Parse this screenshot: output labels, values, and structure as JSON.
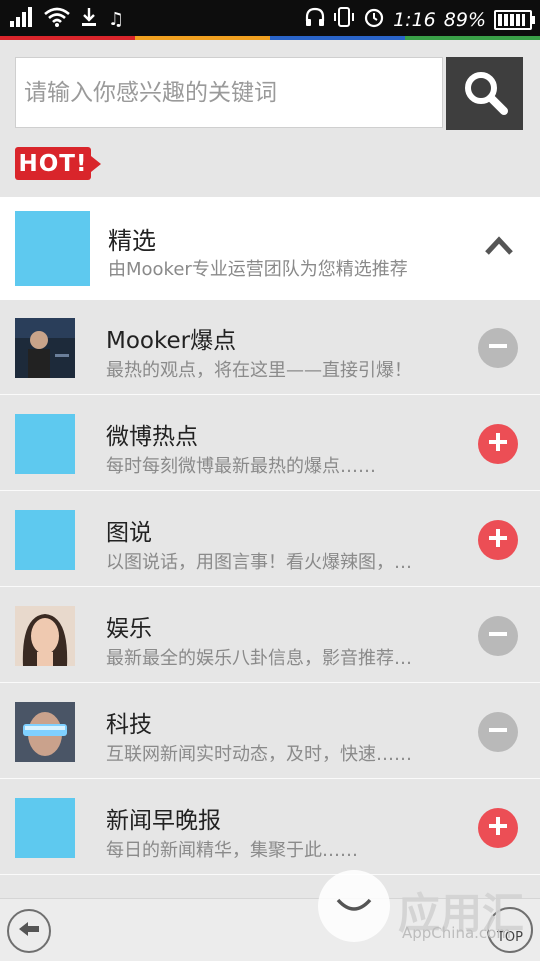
{
  "status_bar": {
    "time": "1:16",
    "battery_percent": "89%",
    "battery_level": 0.89
  },
  "search": {
    "placeholder": "请输入你感兴趣的关键词"
  },
  "hot_badge": "HOT!",
  "featured": {
    "title": "精选",
    "description": "由Mooker专业运营团队为您精选推荐"
  },
  "items": [
    {
      "title": "Mooker爆点",
      "description": "最热的观点，将在这里——直接引爆！",
      "subscribed": true,
      "thumb": "photo-person-stage"
    },
    {
      "title": "微博热点",
      "description": "每时每刻微博最新最热的爆点……",
      "subscribed": false,
      "thumb": "blue-placeholder"
    },
    {
      "title": "图说",
      "description": "以图说话，用图言事！看火爆辣图，…",
      "subscribed": false,
      "thumb": "blue-placeholder"
    },
    {
      "title": "娱乐",
      "description": "最新最全的娱乐八卦信息，影音推荐…",
      "subscribed": true,
      "thumb": "photo-woman-portrait"
    },
    {
      "title": "科技",
      "description": "互联网新闻实时动态，及时，快速……",
      "subscribed": true,
      "thumb": "photo-vr-glasses"
    },
    {
      "title": "新闻早晚报",
      "description": "每日的新闻精华，集聚于此……",
      "subscribed": false,
      "thumb": "blue-placeholder"
    }
  ],
  "bottom": {
    "top_label": "TOP"
  },
  "watermark": {
    "name": "应用汇",
    "sub": "AppChina.com"
  },
  "colors": {
    "accent_blue": "#5ec9ef",
    "add_red": "#ec4e55",
    "remove_gray": "#b9b9b9",
    "hot_red": "#d9252b",
    "color_line": [
      "#d9252b",
      "#f0a020",
      "#2a64c8",
      "#3aa048"
    ]
  }
}
